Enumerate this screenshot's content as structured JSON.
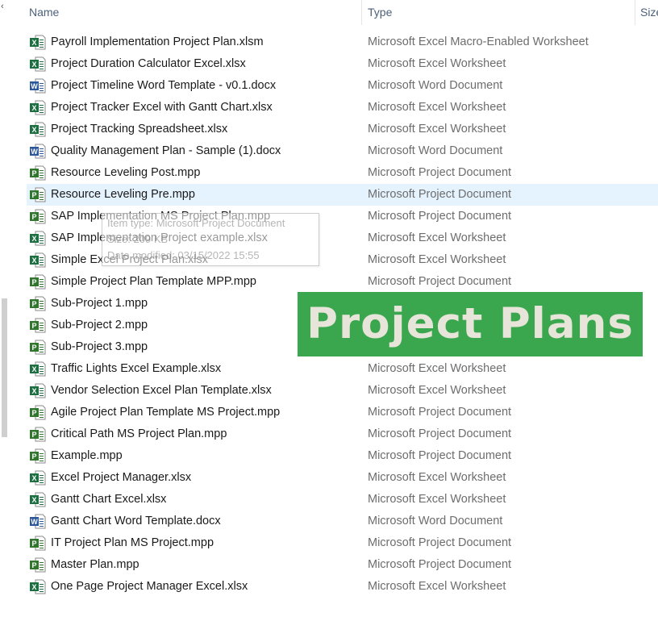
{
  "header": {
    "columns": [
      {
        "key": "name",
        "label": "Name"
      },
      {
        "key": "type",
        "label": "Type"
      },
      {
        "key": "size",
        "label": "Size"
      }
    ]
  },
  "files": [
    {
      "name": "Payroll Implementation Project Plan.xlsm",
      "type": "Microsoft Excel Macro-Enabled Worksheet",
      "kind": "excel"
    },
    {
      "name": "Project Duration Calculator Excel.xlsx",
      "type": "Microsoft Excel Worksheet",
      "kind": "excel"
    },
    {
      "name": "Project Timeline Word Template - v0.1.docx",
      "type": "Microsoft Word Document",
      "kind": "word"
    },
    {
      "name": "Project Tracker Excel with Gantt Chart.xlsx",
      "type": "Microsoft Excel Worksheet",
      "kind": "excel"
    },
    {
      "name": "Project Tracking Spreadsheet.xlsx",
      "type": "Microsoft Excel Worksheet",
      "kind": "excel"
    },
    {
      "name": "Quality Management Plan - Sample (1).docx",
      "type": "Microsoft Word Document",
      "kind": "word"
    },
    {
      "name": "Resource Leveling Post.mpp",
      "type": "Microsoft Project Document",
      "kind": "project"
    },
    {
      "name": "Resource Leveling Pre.mpp",
      "type": "Microsoft Project Document",
      "kind": "project",
      "selected": true
    },
    {
      "name": "SAP Implementation MS Project Plan.mpp",
      "type": "Microsoft Project Document",
      "kind": "project"
    },
    {
      "name": "SAP Implementation Project example.xlsx",
      "type": "Microsoft Excel Worksheet",
      "kind": "excel"
    },
    {
      "name": "Simple Excel Project Plan.xlsx",
      "type": "Microsoft Excel Worksheet",
      "kind": "excel"
    },
    {
      "name": "Simple Project Plan Template MPP.mpp",
      "type": "Microsoft Project Document",
      "kind": "project"
    },
    {
      "name": "Sub-Project 1.mpp",
      "type": "",
      "kind": "project"
    },
    {
      "name": "Sub-Project 2.mpp",
      "type": "",
      "kind": "project"
    },
    {
      "name": "Sub-Project 3.mpp",
      "type": "",
      "kind": "project"
    },
    {
      "name": "Traffic Lights Excel Example.xlsx",
      "type": "Microsoft Excel Worksheet",
      "kind": "excel"
    },
    {
      "name": "Vendor Selection Excel Plan Template.xlsx",
      "type": "Microsoft Excel Worksheet",
      "kind": "excel"
    },
    {
      "name": "Agile Project Plan Template MS Project.mpp",
      "type": "Microsoft Project Document",
      "kind": "project"
    },
    {
      "name": "Critical Path MS Project Plan.mpp",
      "type": "Microsoft Project Document",
      "kind": "project"
    },
    {
      "name": "Example.mpp",
      "type": "Microsoft Project Document",
      "kind": "project"
    },
    {
      "name": "Excel Project Manager.xlsx",
      "type": "Microsoft Excel Worksheet",
      "kind": "excel"
    },
    {
      "name": "Gantt Chart Excel.xlsx",
      "type": "Microsoft Excel Worksheet",
      "kind": "excel"
    },
    {
      "name": "Gantt Chart Word Template.docx",
      "type": "Microsoft Word Document",
      "kind": "word"
    },
    {
      "name": "IT Project Plan MS Project.mpp",
      "type": "Microsoft Project Document",
      "kind": "project"
    },
    {
      "name": "Master Plan.mpp",
      "type": "Microsoft Project Document",
      "kind": "project"
    },
    {
      "name": "One Page Project Manager Excel.xlsx",
      "type": "Microsoft Excel Worksheet",
      "kind": "excel"
    }
  ],
  "tooltip": {
    "line1": "Item type: Microsoft Project Document",
    "line2": "Size: 209 KB",
    "line3": "Date modified: 03/15/2022 15:55"
  },
  "banner": {
    "text": "Project Plans",
    "color": "#3aa64e"
  },
  "colors": {
    "excel": "#1d6f42",
    "word": "#2b579a",
    "project": "#31752f",
    "selected_row": "#e5f3ff"
  }
}
